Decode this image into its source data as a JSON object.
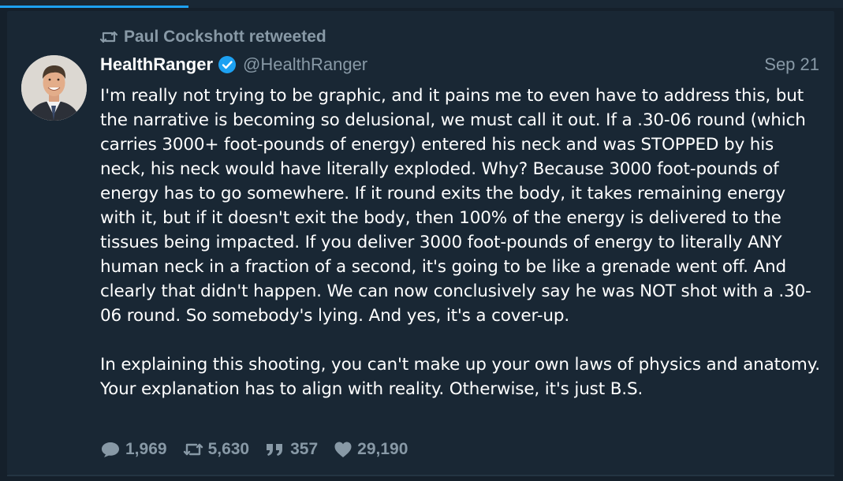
{
  "retweet_context": {
    "icon": "retweet-icon",
    "text": "Paul Cockshott retweeted"
  },
  "author": {
    "display_name": "HealthRanger",
    "verified": true,
    "handle": "@HealthRanger",
    "avatar": "avatar-photo"
  },
  "tweet": {
    "date": "Sep 21",
    "paragraphs": [
      "I'm really not trying to be graphic, and it pains me to even have to address this, but the narrative is becoming so delusional, we must call it out. If a .30-06 round (which carries 3000+ foot-pounds of energy) entered his neck and was STOPPED by his neck, his neck would have literally exploded. Why? Because 3000 foot-pounds of energy has to go somewhere. If it round exits the body, it takes remaining energy with it, but if it doesn't exit the body, then 100% of the energy is delivered to the tissues being impacted. If you deliver 3000 foot-pounds of energy to literally ANY human neck in a fraction of a second, it's going to be like a grenade went off. And clearly that didn't happen. We can now conclusively say he was NOT shot with a .30-06 round. So somebody's lying. And yes, it's a cover-up.",
      "In explaining this shooting, you can't make up your own laws of physics and anatomy. Your explanation has to align with reality. Otherwise, it's just B.S."
    ]
  },
  "actions": {
    "replies": {
      "icon": "reply-icon",
      "count": "1,969"
    },
    "retweets": {
      "icon": "retweet-icon",
      "count": "5,630"
    },
    "quotes": {
      "icon": "quote-icon",
      "count": "357"
    },
    "likes": {
      "icon": "heart-icon",
      "count": "29,190"
    }
  },
  "colors": {
    "background": "#15202b",
    "card": "#192734",
    "accent": "#1da1f2",
    "secondary_text": "#8899a6",
    "primary_text": "#ffffff"
  }
}
